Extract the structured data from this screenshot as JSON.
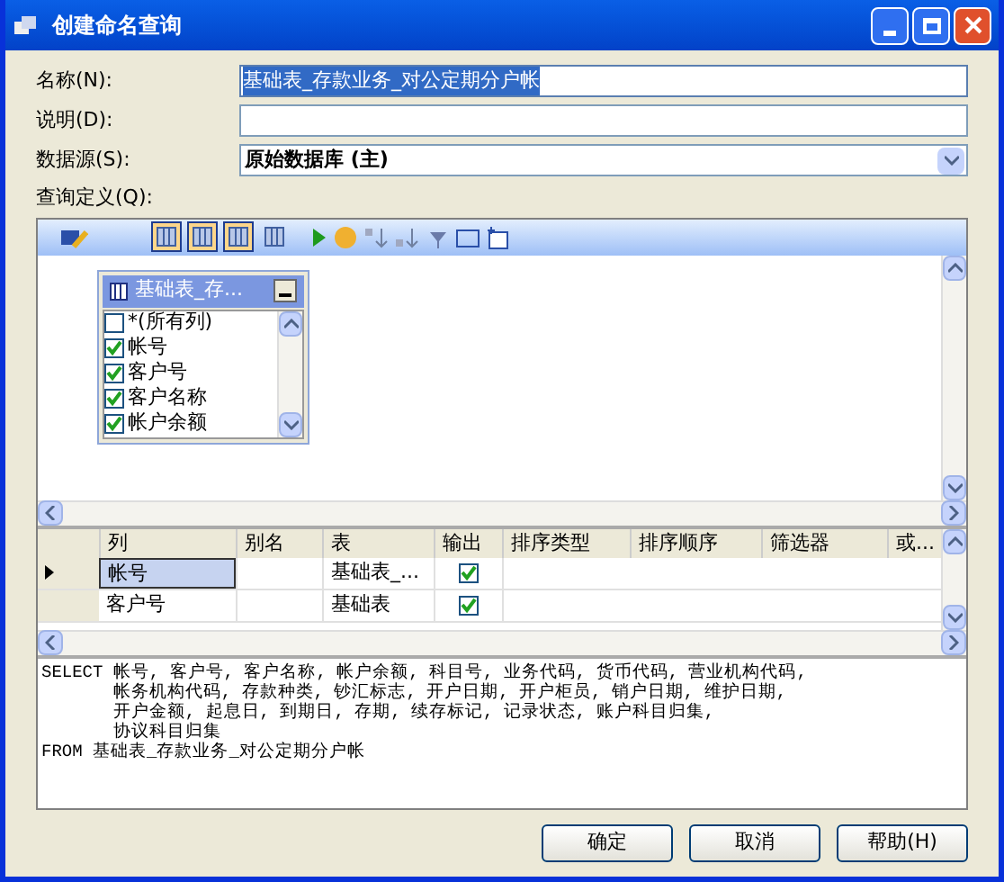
{
  "window": {
    "title": "创建命名查询"
  },
  "fields": [
    {
      "label": "名称(N):",
      "value": "基础表_存款业务_对公定期分户帐",
      "selected": true,
      "kind": "text"
    },
    {
      "label": "说明(D):",
      "selected": false,
      "kind": "text"
    },
    {
      "label": "数据源(S):",
      "value": "原始数据库 (主)",
      "selected": false,
      "kind": "dropdown"
    }
  ],
  "query_label": "查询定义(Q):",
  "pane_toggles": [
    {
      "selected": true
    },
    {
      "selected": true
    },
    {
      "selected": true
    },
    {
      "selected": false
    }
  ],
  "table_window": {
    "title": "基础表_存...",
    "columns": [
      {
        "label": "*(所有列)",
        "checked": false
      },
      {
        "label": "帐号",
        "checked": true
      },
      {
        "label": "客户号",
        "checked": true
      },
      {
        "label": "客户名称",
        "checked": true
      },
      {
        "label": "帐户余额",
        "checked": true
      }
    ]
  },
  "grid": {
    "columns": [
      "列",
      "别名",
      "表",
      "输出",
      "排序类型",
      "排序顺序",
      "筛选器",
      "或..."
    ],
    "rows": [
      {
        "column": "帐号",
        "table": "基础表_...",
        "output": true,
        "selected": true
      },
      {
        "column": "客户号",
        "table": "基础表",
        "output": true,
        "selected": false
      }
    ]
  },
  "sql": [
    "SELECT 帐号, 客户号, 客户名称, 帐户余额, 科目号, 业务代码, 货币代码, 营业机构代码,",
    "       帐务机构代码, 存款种类, 钞汇标志, 开户日期, 开户柜员, 销户日期, 维护日期,",
    "       开户金额, 起息日, 到期日, 存期, 续存标记, 记录状态, 账户科目归集,",
    "       协议科目归集",
    "FROM 基础表_存款业务_对公定期分户帐"
  ],
  "buttons": [
    "确定",
    "取消",
    "帮助(H)"
  ]
}
